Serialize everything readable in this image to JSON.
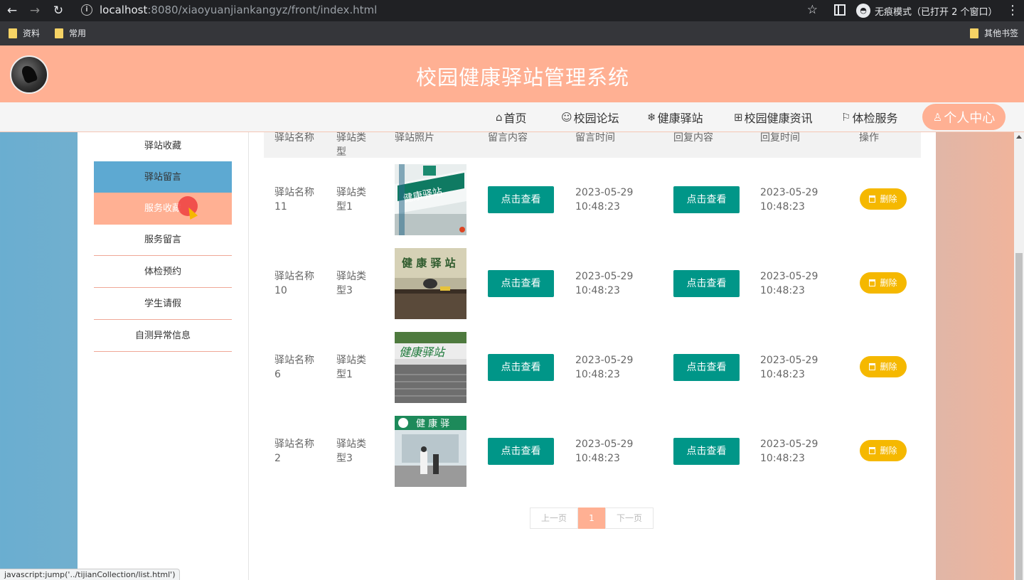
{
  "browser": {
    "url_host": "localhost",
    "url_rest": ":8080/xiaoyuanjiankangyz/front/index.html",
    "incognito_label": "无痕模式（已打开 2 个窗口）",
    "bookmarks": [
      "资料",
      "常用"
    ],
    "other_bookmarks": "其他书签",
    "status_url": "javascript:jump('../tijianCollection/list.html')"
  },
  "header": {
    "title": "校园健康驿站管理系统"
  },
  "nav": {
    "items": [
      "首页",
      "校园论坛",
      "健康驿站",
      "校园健康资讯",
      "体检服务"
    ],
    "personal": "个人中心"
  },
  "sidebar": {
    "items": [
      "驿站收藏",
      "驿站留言",
      "服务收藏",
      "服务留言",
      "体检预约",
      "学生请假",
      "自测异常信息"
    ]
  },
  "table": {
    "headers": [
      "驿站名称",
      "驿站类型",
      "驿站照片",
      "留言内容",
      "留言时间",
      "回复内容",
      "回复时间",
      "操作"
    ],
    "view_label": "点击查看",
    "delete_label": "删除",
    "rows": [
      {
        "name_line1": "驿站名称",
        "name_line2": "11",
        "type_line1": "驿站类",
        "type_line2": "型1",
        "msg_date": "2023-05-29",
        "msg_time": "10:48:23",
        "reply_date": "2023-05-29",
        "reply_time": "10:48:23"
      },
      {
        "name_line1": "驿站名称",
        "name_line2": "10",
        "type_line1": "驿站类",
        "type_line2": "型3",
        "msg_date": "2023-05-29",
        "msg_time": "10:48:23",
        "reply_date": "2023-05-29",
        "reply_time": "10:48:23"
      },
      {
        "name_line1": "驿站名称",
        "name_line2": "6",
        "type_line1": "驿站类",
        "type_line2": "型1",
        "msg_date": "2023-05-29",
        "msg_time": "10:48:23",
        "reply_date": "2023-05-29",
        "reply_time": "10:48:23"
      },
      {
        "name_line1": "驿站名称",
        "name_line2": "2",
        "type_line1": "驿站类",
        "type_line2": "型3",
        "msg_date": "2023-05-29",
        "msg_time": "10:48:23",
        "reply_date": "2023-05-29",
        "reply_time": "10:48:23"
      }
    ]
  },
  "photos": {
    "photo1": "健康驿站",
    "photo2": "健 康 驿 站",
    "photo3": "健康驿站",
    "photo4": "健 康 驿"
  },
  "pager": {
    "prev": "上一页",
    "current": "1",
    "next": "下一页"
  }
}
